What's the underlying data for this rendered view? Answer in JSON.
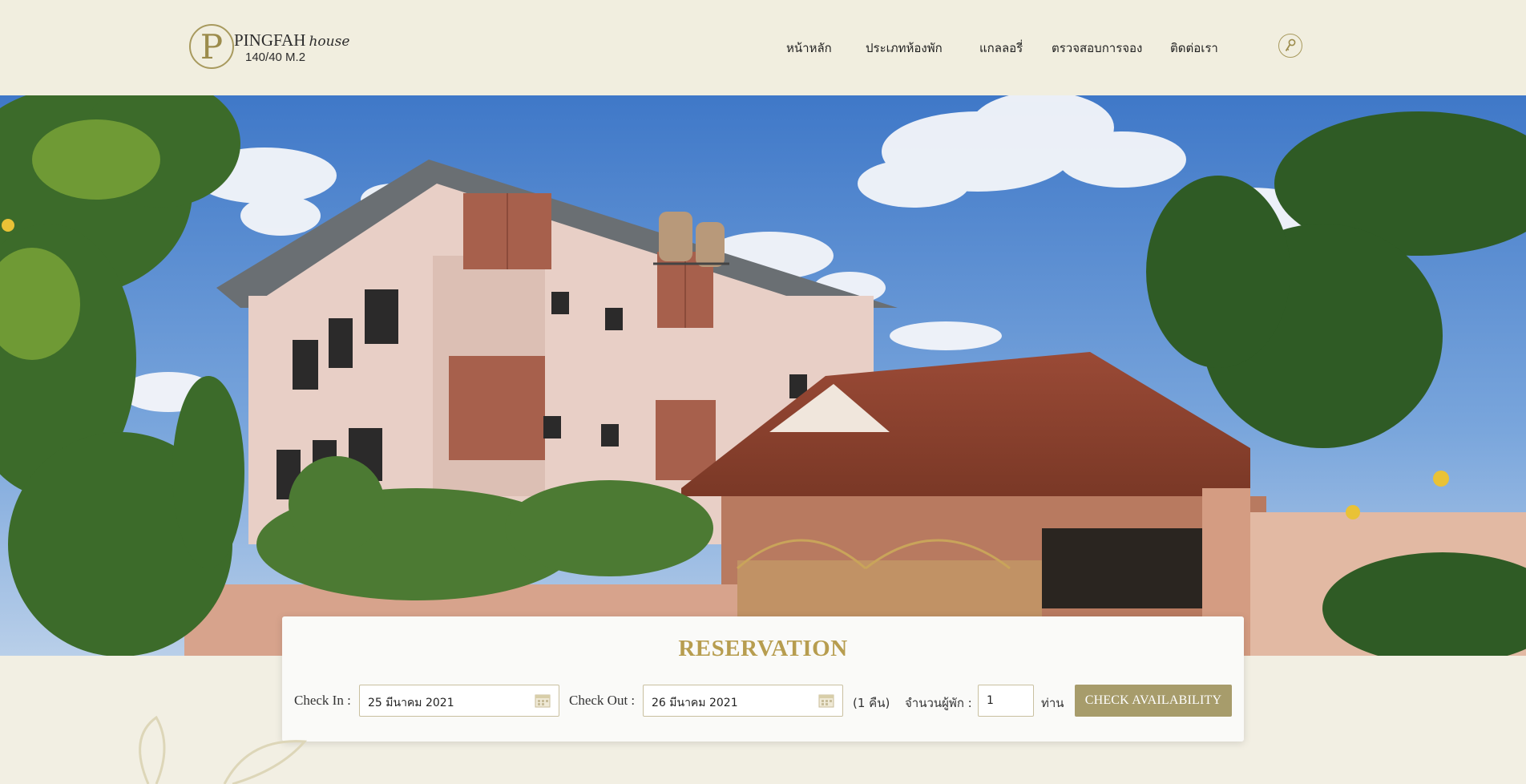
{
  "brand": {
    "logo_letter": "P",
    "name": "PINGFAH",
    "name_script": "house",
    "address": "140/40 M.2",
    "accent_color": "#a89a5e"
  },
  "nav": {
    "items": [
      {
        "label": "หน้าหลัก"
      },
      {
        "label": "ประเภทห้องพัก"
      },
      {
        "label": "แกลลอรี่"
      },
      {
        "label": "ตรวจสอบการจอง"
      },
      {
        "label": "ติดต่อเรา"
      }
    ],
    "login_icon": "key-icon"
  },
  "hero": {
    "image": "guesthouse-exterior-photo"
  },
  "reservation": {
    "title": "RESERVATION",
    "check_in_label": "Check In :",
    "check_in_value": "25 มีนาคม 2021",
    "check_out_label": "Check Out :",
    "check_out_value": "26 มีนาคม 2021",
    "nights": "(1 คืน)",
    "guests_label": "จำนวนผู้พัก :",
    "guests_value": "1",
    "guests_unit": "ท่าน",
    "button_label": "CHECK AVAILABILITY",
    "button_color": "#a79c6b",
    "title_color": "#b79d4f"
  }
}
